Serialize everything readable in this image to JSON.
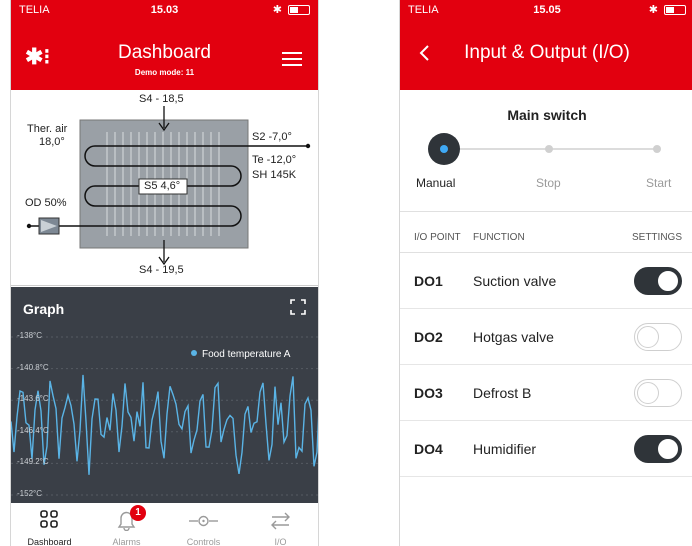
{
  "left_screen": {
    "status_bar": {
      "carrier": "TELIA",
      "time": "15.03"
    },
    "header": {
      "title": "Dashboard",
      "subtitle": "Demo mode: 11"
    },
    "diagram": {
      "s4_top": "S4 - 18,5",
      "ther_air_label": "Ther. air",
      "ther_air_value": "18,0°",
      "s2": "S2 -7,0°",
      "te": "Te -12,0°",
      "sh": "SH 145K",
      "s5": "S5 4,6°",
      "od": "OD 50%",
      "s4_bottom": "S4 - 19,5"
    },
    "graph": {
      "title": "Graph",
      "legend": "Food temperature A",
      "series_color": "#5ab4e6",
      "y_labels": [
        "-138°C",
        "-140.8°C",
        "-143.6°C",
        "-146.4°C",
        "-149.2°C",
        "-152°C"
      ]
    },
    "bottom_nav": {
      "items": [
        {
          "label": "Dashboard",
          "icon": "grid-icon"
        },
        {
          "label": "Alarms",
          "icon": "bell-icon",
          "badge": "1"
        },
        {
          "label": "Controls",
          "icon": "controls-icon"
        },
        {
          "label": "I/O",
          "icon": "swap-arrows-icon"
        }
      ]
    }
  },
  "right_screen": {
    "status_bar": {
      "carrier": "TELIA",
      "time": "15.05"
    },
    "header": {
      "title": "Input & Output (I/O)"
    },
    "main_switch": {
      "title": "Main switch",
      "options": [
        "Manual",
        "Stop",
        "Start"
      ],
      "selected": "Manual"
    },
    "table": {
      "headers": {
        "point": "I/O POINT",
        "function": "FUNCTION",
        "settings": "SETTINGS"
      },
      "rows": [
        {
          "point": "DO1",
          "function": "Suction valve",
          "on": true
        },
        {
          "point": "DO2",
          "function": "Hotgas valve",
          "on": false
        },
        {
          "point": "DO3",
          "function": "Defrost B",
          "on": false
        },
        {
          "point": "DO4",
          "function": "Humidifier",
          "on": true
        }
      ]
    }
  },
  "colors": {
    "brand_red": "#e2000f",
    "dark": "#2f3439",
    "accent_blue": "#3fa9f5"
  }
}
